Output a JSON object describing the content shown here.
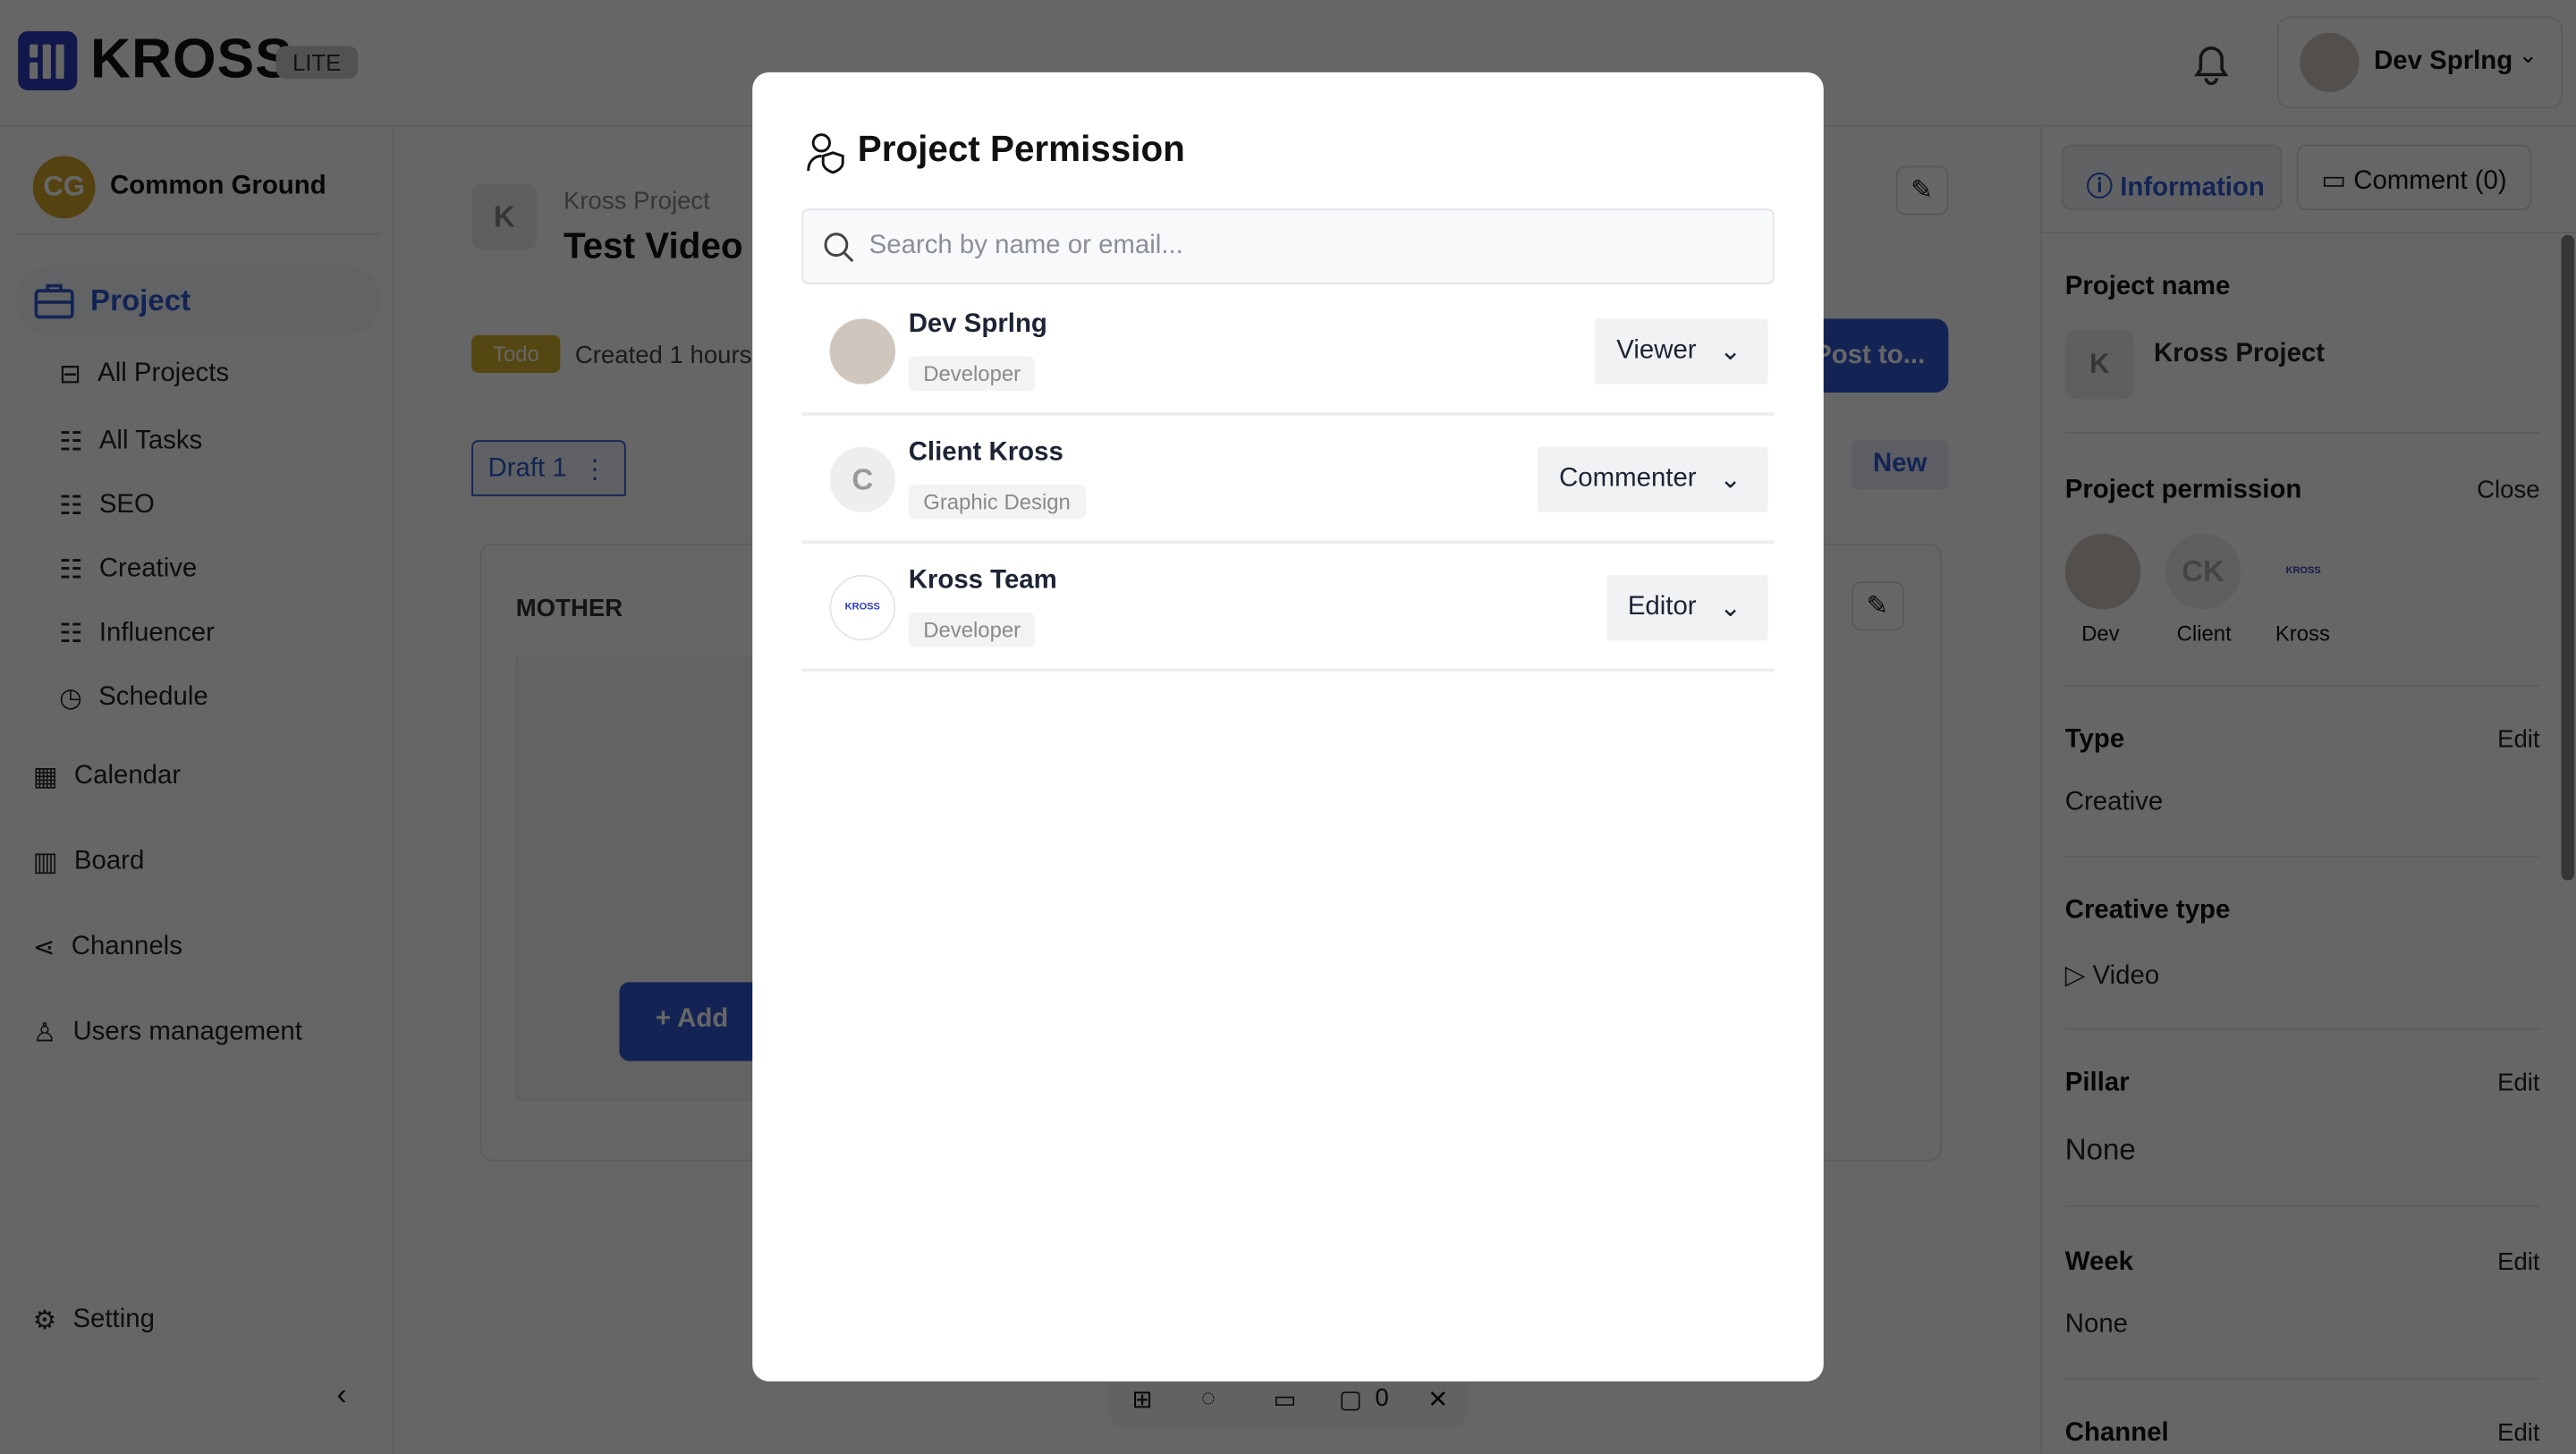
{
  "app": {
    "brand": "KROSS",
    "badge": "LITE",
    "user_name": "Dev Sprlng"
  },
  "sidebar": {
    "workspace_initials": "CG",
    "workspace_name": "Common Ground",
    "section": "Project",
    "sub_items": [
      {
        "label": "All Projects",
        "icon": "briefcase-icon"
      },
      {
        "label": "All Tasks",
        "icon": "list-icon"
      },
      {
        "label": "SEO",
        "icon": "list-icon"
      },
      {
        "label": "Creative",
        "icon": "list-icon"
      },
      {
        "label": "Influencer",
        "icon": "list-icon"
      },
      {
        "label": "Schedule",
        "icon": "clock-icon"
      }
    ],
    "items": [
      {
        "label": "Calendar",
        "icon": "calendar-icon"
      },
      {
        "label": "Board",
        "icon": "board-icon"
      },
      {
        "label": "Channels",
        "icon": "share-icon"
      },
      {
        "label": "Users management",
        "icon": "user-icon"
      }
    ],
    "setting": "Setting"
  },
  "main": {
    "project_initial": "K",
    "project_name": "Kross Project",
    "title": "Test Video",
    "status": "Todo",
    "created": "Created 1 hours",
    "post_button": "Post to...",
    "draft_tab": "Draft 1",
    "new_button": "New",
    "section": "MOTHER",
    "add_button": "Add",
    "toolbar_comment_count": "0"
  },
  "right_panel": {
    "tabs": {
      "information": "Information",
      "comment": "Comment (0)"
    },
    "project_name_label": "Project name",
    "project_initial": "K",
    "project_name": "Kross Project",
    "permission_label": "Project permission",
    "close": "Close",
    "members": [
      {
        "initials": "",
        "name": "Dev"
      },
      {
        "initials": "CK",
        "name": "Client"
      },
      {
        "initials": "",
        "name": "Kross"
      }
    ],
    "type_label": "Type",
    "type_value": "Creative",
    "edit": "Edit",
    "creative_type_label": "Creative type",
    "creative_type_value": "Video",
    "pillar_label": "Pillar",
    "pillar_value": "None",
    "week_label": "Week",
    "week_value": "None",
    "channel_label": "Channel"
  },
  "modal": {
    "title": "Project Permission",
    "search_placeholder": "Search by name or email...",
    "members": [
      {
        "name": "Dev Sprlng",
        "tag": "Developer",
        "role": "Viewer",
        "avatar": "photo"
      },
      {
        "name": "Client Kross",
        "tag": "Graphic Design",
        "role": "Commenter",
        "avatar": "C"
      },
      {
        "name": "Kross Team",
        "tag": "Developer",
        "role": "Editor",
        "avatar": "kross-logo"
      }
    ],
    "kross_logo_text": "KROSS"
  },
  "colors": {
    "brand": "#2d3bbf",
    "accent": "#2f5bd3",
    "todo": "#d4b22a",
    "overlay": "rgba(0,0,0,0.6)"
  }
}
